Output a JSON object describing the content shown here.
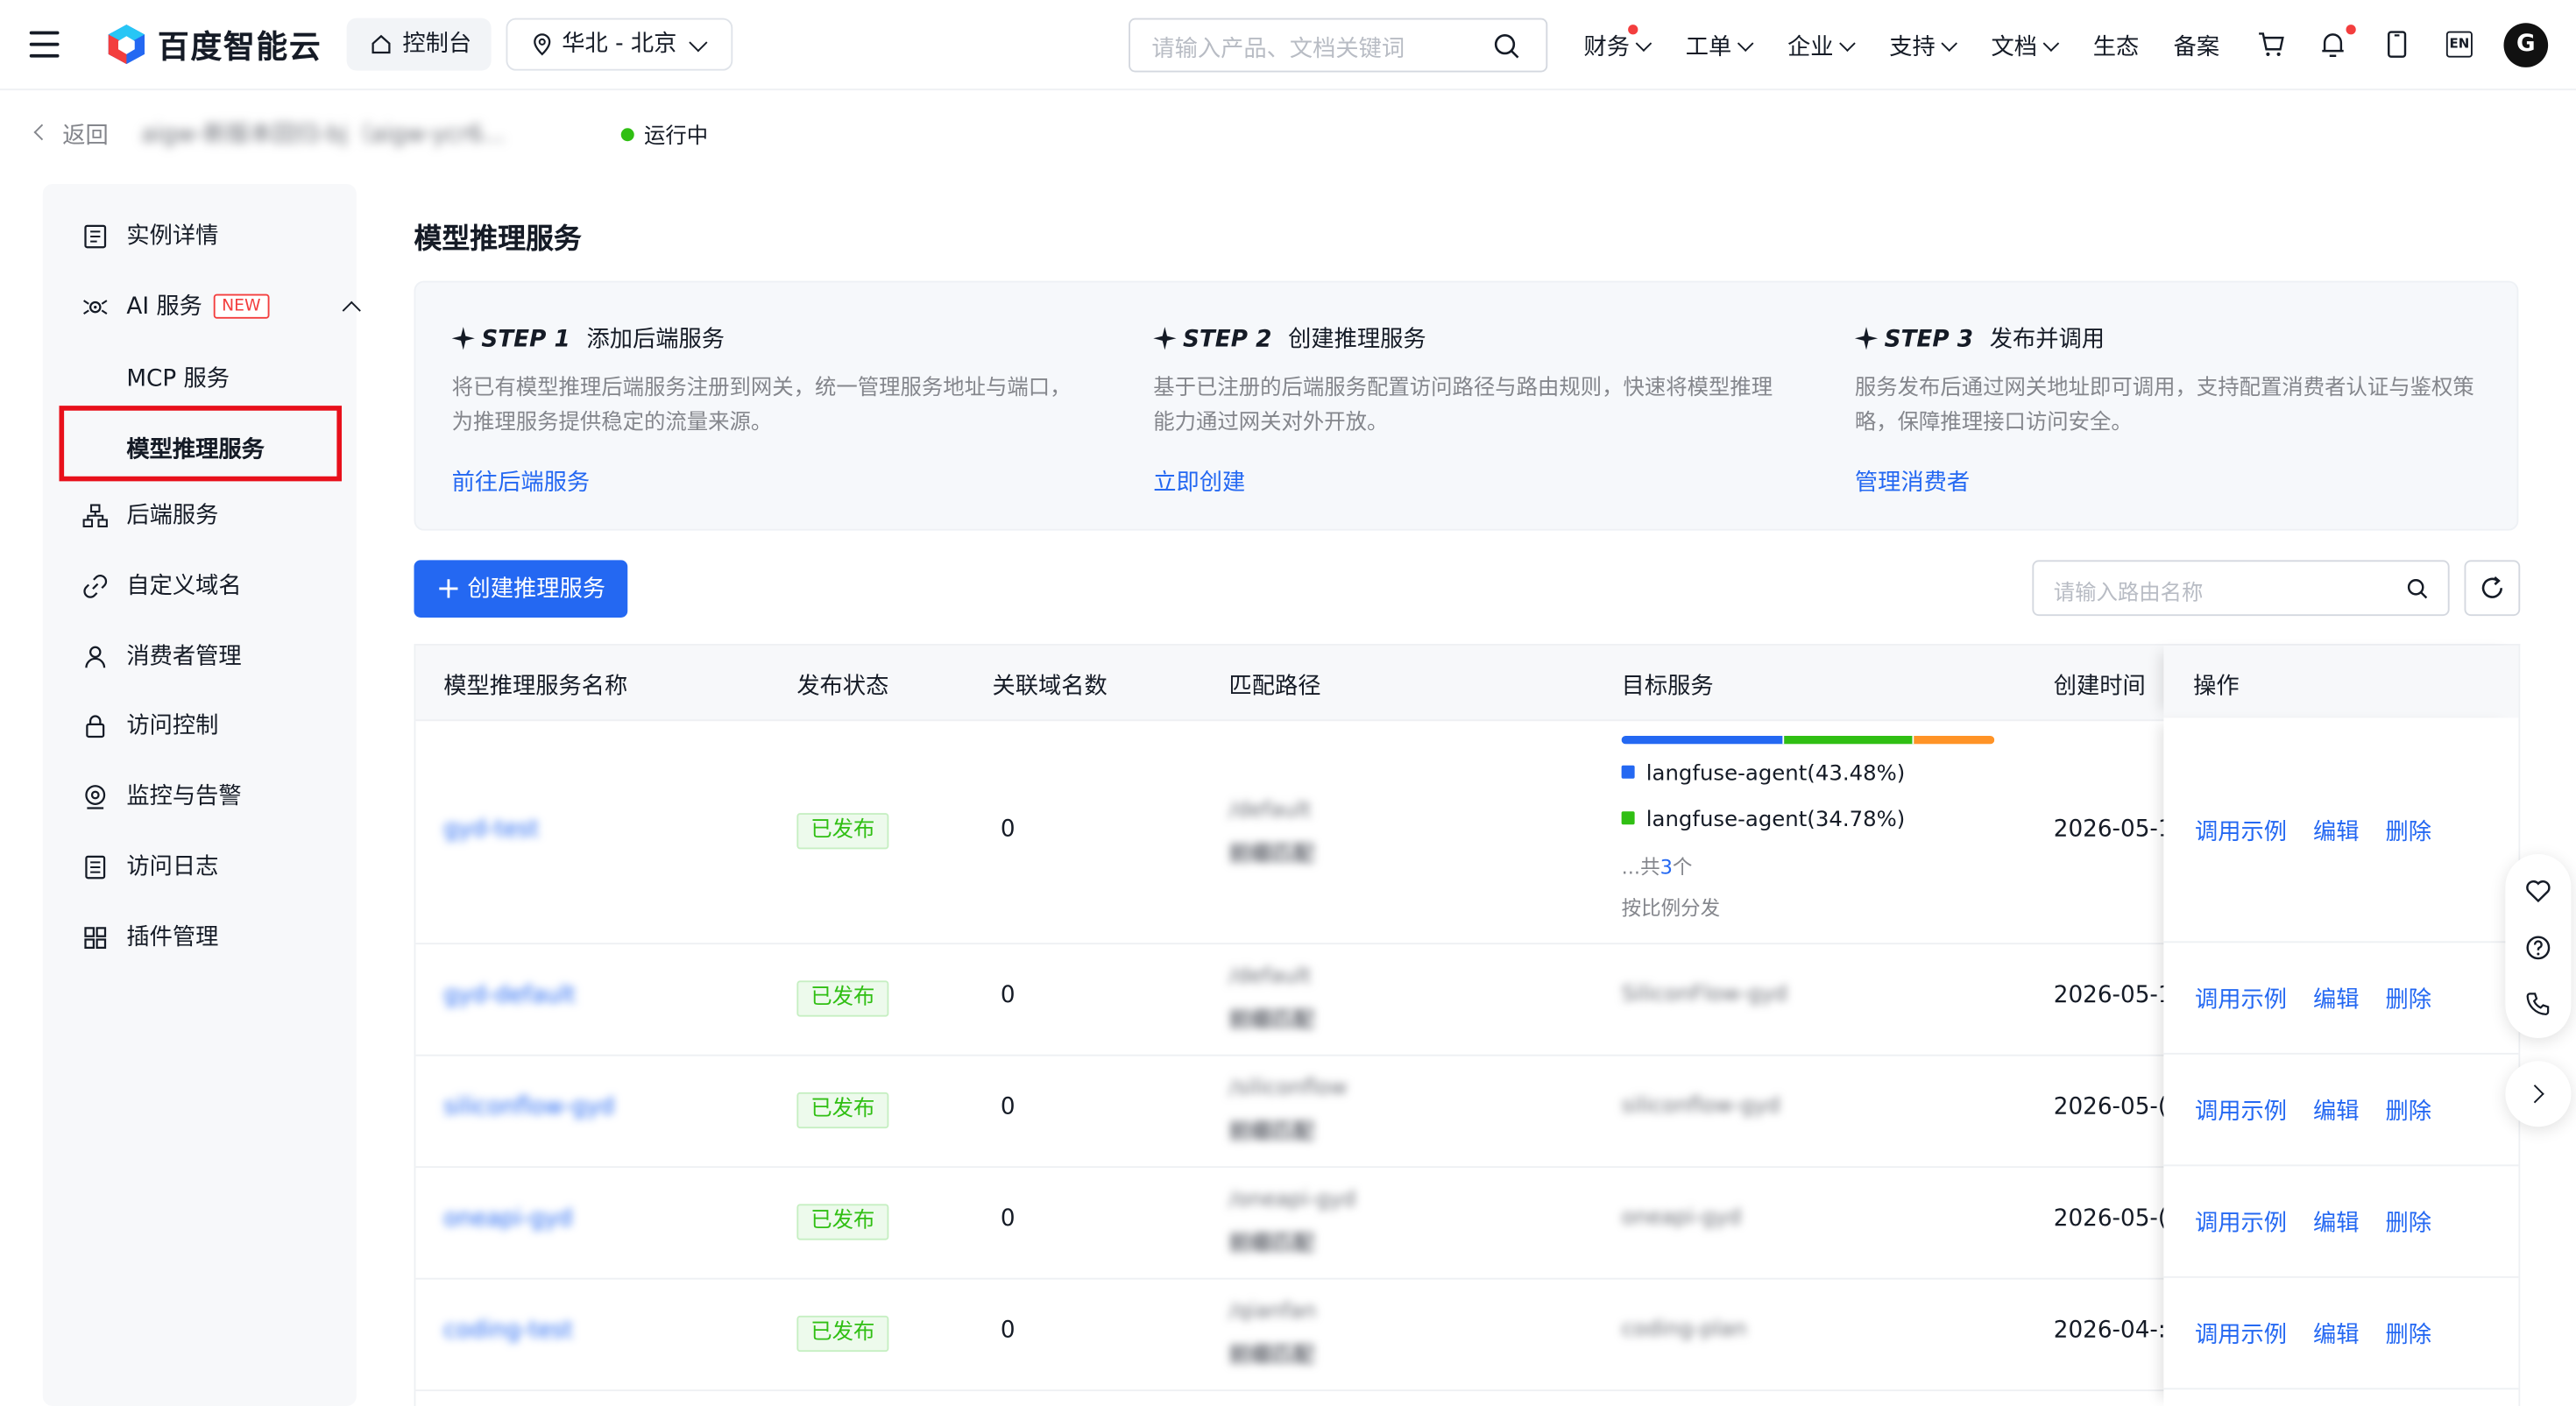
{
  "header": {
    "logo_text": "百度智能云",
    "console_label": "控制台",
    "region_label": "华北 - 北京",
    "search_placeholder": "请输入产品、文档关键词",
    "nav": [
      "财务",
      "工单",
      "企业",
      "支持",
      "文档",
      "生态",
      "备案"
    ],
    "lang_label": "EN",
    "avatar_letter": "G"
  },
  "breadcrumb": {
    "back_label": "返回",
    "instance_title": "aigw-新版本回归-bj（aigw-ycr6...",
    "status": "运行中"
  },
  "sidebar": {
    "items": [
      {
        "label": "实例详情"
      },
      {
        "label": "AI 服务",
        "badge": "NEW"
      },
      {
        "label": "MCP 服务"
      },
      {
        "label": "模型推理服务"
      },
      {
        "label": "后端服务"
      },
      {
        "label": "自定义域名"
      },
      {
        "label": "消费者管理"
      },
      {
        "label": "访问控制"
      },
      {
        "label": "监控与告警"
      },
      {
        "label": "访问日志"
      },
      {
        "label": "插件管理"
      }
    ]
  },
  "main": {
    "title": "模型推理服务",
    "steps": [
      {
        "step": "STEP 1",
        "title": "添加后端服务",
        "desc": "将已有模型推理后端服务注册到网关，统一管理服务地址与端口，为推理服务提供稳定的流量来源。",
        "link": "前往后端服务"
      },
      {
        "step": "STEP 2",
        "title": "创建推理服务",
        "desc": "基于已注册的后端服务配置访问路径与路由规则，快速将模型推理能力通过网关对外开放。",
        "link": "立即创建"
      },
      {
        "step": "STEP 3",
        "title": "发布并调用",
        "desc": "服务发布后通过网关地址即可调用，支持配置消费者认证与鉴权策略，保障推理接口访问安全。",
        "link": "管理消费者"
      }
    ],
    "create_button": "创建推理服务",
    "route_search_placeholder": "请输入路由名称"
  },
  "table": {
    "columns": [
      "模型推理服务名称",
      "发布状态",
      "关联域名数",
      "匹配路径",
      "目标服务",
      "创建时间",
      "操作"
    ],
    "actions": [
      "调用示例",
      "编辑",
      "删除"
    ],
    "rows": [
      {
        "name": "gyd-test",
        "status": "已发布",
        "domains": "0",
        "path": "/default",
        "match": "前缀匹配",
        "created": "2026-05-1",
        "targets": [
          {
            "name": "langfuse-agent(43.48%)",
            "color": "#2468f2",
            "weight": 43.48
          },
          {
            "name": "langfuse-agent(34.78%)",
            "color": "#30bf13",
            "weight": 34.78
          },
          {
            "name": "",
            "color": "#ff9326",
            "weight": 21.74
          }
        ],
        "more_prefix": "...共",
        "more_count": "3",
        "more_suffix": "个",
        "dist_note": "按比例分发"
      },
      {
        "name": "gyd-default",
        "status": "已发布",
        "domains": "0",
        "path": "/default",
        "match": "前缀匹配",
        "target": "SiliconFlow-gyd",
        "created": "2026-05-1"
      },
      {
        "name": "siliconflow-gyd",
        "status": "已发布",
        "domains": "0",
        "path": "/siliconflow",
        "match": "前缀匹配",
        "target": "siliconflow-gyd",
        "created": "2026-05-("
      },
      {
        "name": "oneapi-gyd",
        "status": "已发布",
        "domains": "0",
        "path": "/oneapi-gyd",
        "match": "前缀匹配",
        "target": "oneapi-gyd",
        "created": "2026-05-("
      },
      {
        "name": "coding-test",
        "status": "已发布",
        "domains": "0",
        "path": "/qianfan",
        "match": "前缀匹配",
        "target": "coding-plan",
        "created": "2026-04-:"
      }
    ]
  },
  "colors": {
    "primary": "#2468f2",
    "success": "#30bf13",
    "highlight": "#e8101b"
  }
}
